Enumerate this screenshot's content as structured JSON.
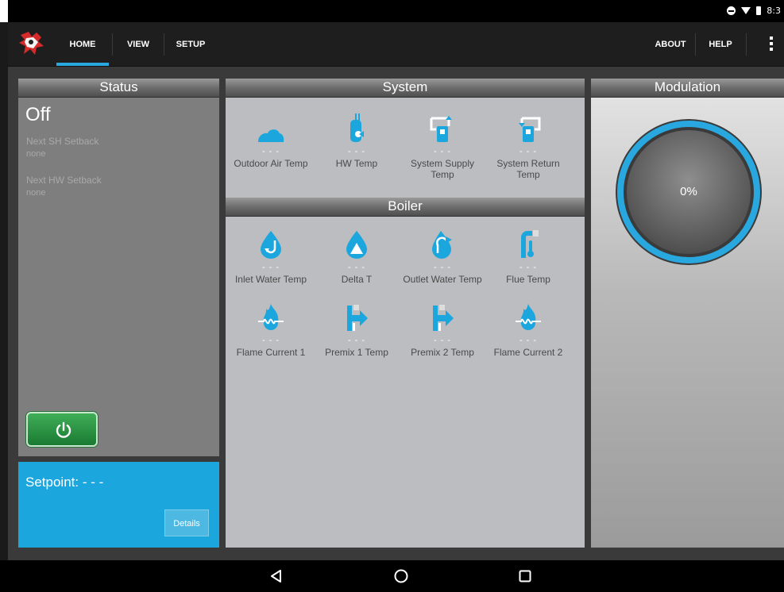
{
  "status_bar": {
    "time": "8:3"
  },
  "app": {
    "tabs": [
      {
        "label": "HOME",
        "active": true
      },
      {
        "label": "VIEW",
        "active": false
      },
      {
        "label": "SETUP",
        "active": false
      }
    ],
    "about_label": "ABOUT",
    "help_label": "HELP",
    "accent_color": "#29a8e0"
  },
  "status": {
    "title": "Status",
    "state": "Off",
    "sh_setback_label": "Next SH Setback",
    "sh_setback_value": "none",
    "hw_setback_label": "Next HW Setback",
    "hw_setback_value": "none",
    "power_icon": "power-icon"
  },
  "setpoint": {
    "label": "Setpoint: - - -",
    "details_label": "Details"
  },
  "system": {
    "title": "System",
    "sensors": [
      {
        "icon": "outdoor-air-icon",
        "value": "- - -",
        "label": "Outdoor Air Temp"
      },
      {
        "icon": "hot-water-tank-icon",
        "value": "- - -",
        "label": "HW Temp"
      },
      {
        "icon": "system-supply-icon",
        "value": "- - -",
        "label": "System Supply Temp"
      },
      {
        "icon": "system-return-icon",
        "value": "- - -",
        "label": "System Return Temp"
      }
    ]
  },
  "boiler": {
    "title": "Boiler",
    "sensors": [
      {
        "icon": "inlet-water-icon",
        "value": "- - -",
        "label": "Inlet Water Temp"
      },
      {
        "icon": "delta-t-icon",
        "value": "- - -",
        "label": "Delta T"
      },
      {
        "icon": "outlet-water-icon",
        "value": "- - -",
        "label": "Outlet Water Temp"
      },
      {
        "icon": "flue-temp-icon",
        "value": "- - -",
        "label": "Flue Temp"
      },
      {
        "icon": "flame-current-icon",
        "value": "- - -",
        "label": "Flame Current 1"
      },
      {
        "icon": "premix-icon",
        "value": "- - -",
        "label": "Premix 1 Temp"
      },
      {
        "icon": "premix-icon",
        "value": "- - -",
        "label": "Premix 2 Temp"
      },
      {
        "icon": "flame-current-icon",
        "value": "- - -",
        "label": "Flame Current 2"
      }
    ]
  },
  "modulation": {
    "title": "Modulation",
    "value_text": "0%",
    "value": 0
  },
  "colors": {
    "icon_blue": "#1ba7dd",
    "setpoint_bg": "#1ba7dd",
    "power_green": "#2e9a48"
  }
}
